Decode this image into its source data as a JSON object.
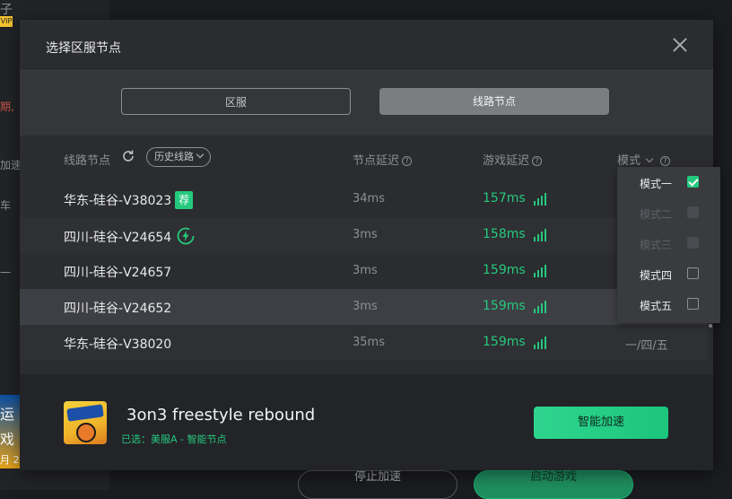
{
  "background": {
    "side_texts": [
      "子",
      "期,",
      "加速",
      "车",
      "一"
    ],
    "badge": "VIP",
    "banner_texts": [
      "运",
      "戏",
      "月 2"
    ],
    "stop_button": "停止加速",
    "start_button": "启动游戏"
  },
  "modal": {
    "title": "选择区服节点",
    "tabs": [
      {
        "label": "区服",
        "active": false
      },
      {
        "label": "线路节点",
        "active": true
      }
    ],
    "headers": {
      "line_node": "线路节点",
      "history": "历史线路",
      "node_latency": "节点延迟",
      "game_latency": "游戏延迟",
      "mode": "模式"
    },
    "rows": [
      {
        "name": "华东-硅谷-V38023",
        "badge": "荐",
        "node_latency": "34ms",
        "game_latency": "157ms",
        "mode": ""
      },
      {
        "name": "四川-硅谷-V24654",
        "badge": "",
        "node_latency": "3ms",
        "game_latency": "158ms",
        "mode": ""
      },
      {
        "name": "四川-硅谷-V24657",
        "badge": "",
        "node_latency": "3ms",
        "game_latency": "159ms",
        "mode": ""
      },
      {
        "name": "四川-硅谷-V24652",
        "badge": "",
        "node_latency": "3ms",
        "game_latency": "159ms",
        "mode": ""
      },
      {
        "name": "华东-硅谷-V38020",
        "badge": "",
        "node_latency": "35ms",
        "game_latency": "159ms",
        "mode": "一/四/五"
      }
    ],
    "mode_options": [
      {
        "label": "模式一",
        "checked": true,
        "disabled": false
      },
      {
        "label": "模式二",
        "checked": false,
        "disabled": true
      },
      {
        "label": "模式三",
        "checked": false,
        "disabled": true
      },
      {
        "label": "模式四",
        "checked": false,
        "disabled": false
      },
      {
        "label": "模式五",
        "checked": false,
        "disabled": false
      }
    ],
    "footer": {
      "game_title": "3on3 freestyle rebound",
      "selected": "已选：美服A - 智能节点",
      "accelerate_button": "智能加速"
    }
  },
  "colors": {
    "accent": "#25c97d",
    "modal_bg": "#2b2c30",
    "text": "#e8e9eb",
    "muted": "#8d8f93"
  }
}
